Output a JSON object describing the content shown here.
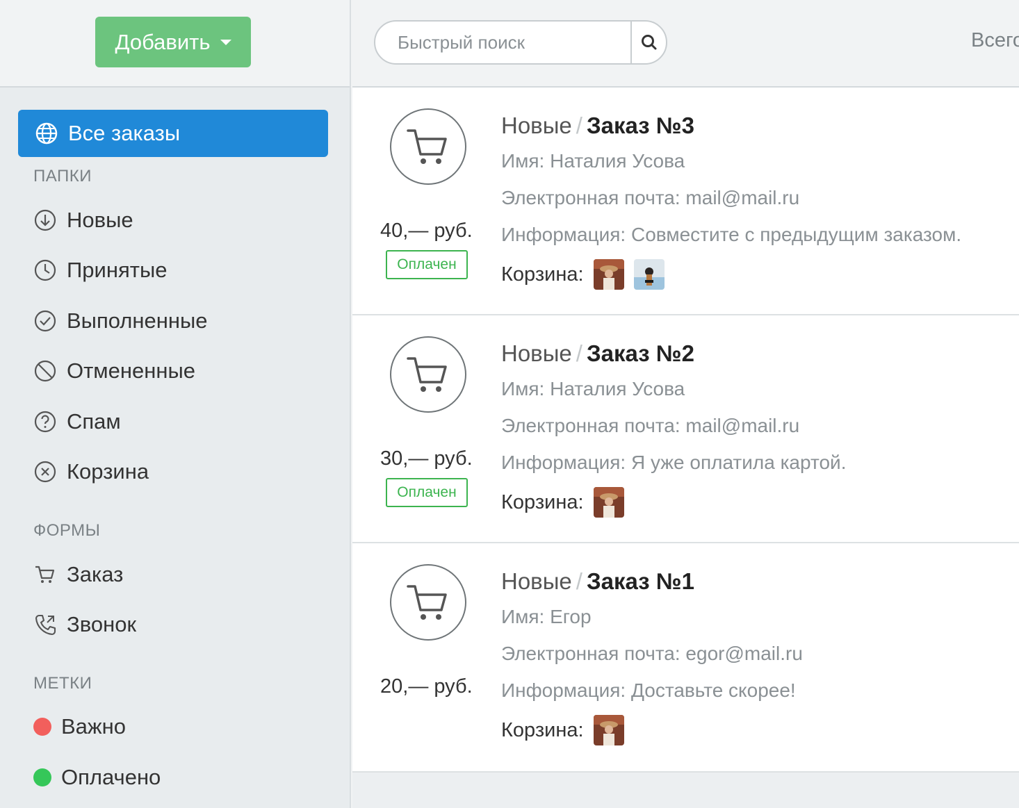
{
  "sidebar": {
    "add_button": "Добавить",
    "all_orders": "Все заказы",
    "folders_label": "ПАПКИ",
    "folders": [
      {
        "label": "Новые",
        "icon": "arrow-down-circle-icon"
      },
      {
        "label": "Принятые",
        "icon": "clock-icon"
      },
      {
        "label": "Выполненные",
        "icon": "check-circle-icon"
      },
      {
        "label": "Отмененные",
        "icon": "ban-icon"
      },
      {
        "label": "Спам",
        "icon": "question-circle-icon"
      },
      {
        "label": "Корзина",
        "icon": "x-circle-icon"
      }
    ],
    "forms_label": "ФОРМЫ",
    "forms": [
      {
        "label": "Заказ",
        "icon": "cart-icon"
      },
      {
        "label": "Звонок",
        "icon": "phone-icon"
      }
    ],
    "tags_label": "МЕТКИ",
    "tags": [
      {
        "label": "Важно",
        "color": "#f25f5c"
      },
      {
        "label": "Оплачено",
        "color": "#35c759"
      }
    ]
  },
  "topbar": {
    "search_placeholder": "Быстрый поиск",
    "total_label": "Всего"
  },
  "orders": [
    {
      "folder": "Новые",
      "separator": "/",
      "title": "Заказ №3",
      "name": "Имя: Наталия Усова",
      "email": "Электронная почта: mail@mail.ru",
      "info": "Информация: Совместите с предыдущим заказом.",
      "basket_label": "Корзина:",
      "price": "40,— руб.",
      "status": "Оплачен"
    },
    {
      "folder": "Новые",
      "separator": "/",
      "title": "Заказ №2",
      "name": "Имя: Наталия Усова",
      "email": "Электронная почта: mail@mail.ru",
      "info": "Информация: Я уже оплатила картой.",
      "basket_label": "Корзина:",
      "price": "30,— руб.",
      "status": "Оплачен"
    },
    {
      "folder": "Новые",
      "separator": "/",
      "title": "Заказ №1",
      "name": "Имя: Егор",
      "email": "Электронная почта: egor@mail.ru",
      "info": "Информация: Доставьте скорее!",
      "basket_label": "Корзина:",
      "price": "20,— руб."
    }
  ],
  "colors": {
    "accent_blue": "#2089d8",
    "add_green": "#6cc47e",
    "paid_green": "#3cb44f"
  }
}
